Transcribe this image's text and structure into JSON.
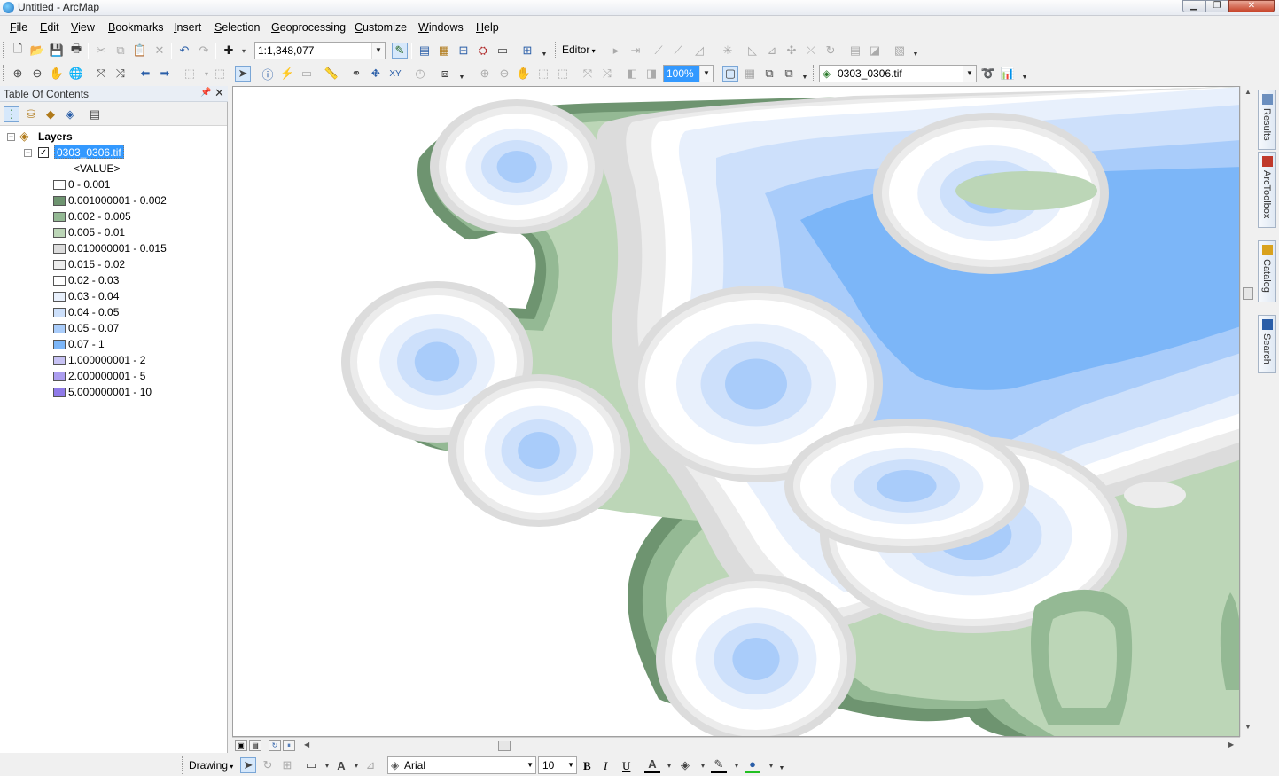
{
  "window": {
    "title": "Untitled - ArcMap"
  },
  "menu": [
    "File",
    "Edit",
    "View",
    "Bookmarks",
    "Insert",
    "Selection",
    "Geoprocessing",
    "Customize",
    "Windows",
    "Help"
  ],
  "toolbar": {
    "scale_value": "1:1,348,077",
    "editor_label": "Editor",
    "transparency_value": "100%",
    "layer_select_value": "0303_0306.tif"
  },
  "toc": {
    "title": "Table Of Contents",
    "layers_label": "Layers",
    "layer_name": "0303_0306.tif",
    "layer_checked": true,
    "field_label": "<VALUE>",
    "legend": [
      {
        "label": "0 - 0.001",
        "color": "#ffffff"
      },
      {
        "label": "0.001000001 - 0.002",
        "color": "#6e9470"
      },
      {
        "label": "0.002 - 0.005",
        "color": "#94b994"
      },
      {
        "label": "0.005 - 0.01",
        "color": "#bcd6b7"
      },
      {
        "label": "0.010000001 - 0.015",
        "color": "#dcdcdc"
      },
      {
        "label": "0.015 - 0.02",
        "color": "#ececec"
      },
      {
        "label": "0.02 - 0.03",
        "color": "#ffffff"
      },
      {
        "label": "0.03 - 0.04",
        "color": "#e8f0fc"
      },
      {
        "label": "0.04 - 0.05",
        "color": "#cde0fb"
      },
      {
        "label": "0.05 - 0.07",
        "color": "#a9ccfa"
      },
      {
        "label": "0.07 - 1",
        "color": "#7cb6f8"
      },
      {
        "label": "1.000000001 - 2",
        "color": "#c7c2f4"
      },
      {
        "label": "2.000000001 - 5",
        "color": "#ac9ef0"
      },
      {
        "label": "5.000000001 - 10",
        "color": "#8f7ae8"
      }
    ]
  },
  "right_dock": [
    "Results",
    "ArcToolbox",
    "Catalog",
    "Search"
  ],
  "drawing": {
    "label": "Drawing",
    "font_name": "Arial",
    "font_size": "10",
    "bold": "B",
    "italic": "I",
    "underline": "U"
  }
}
